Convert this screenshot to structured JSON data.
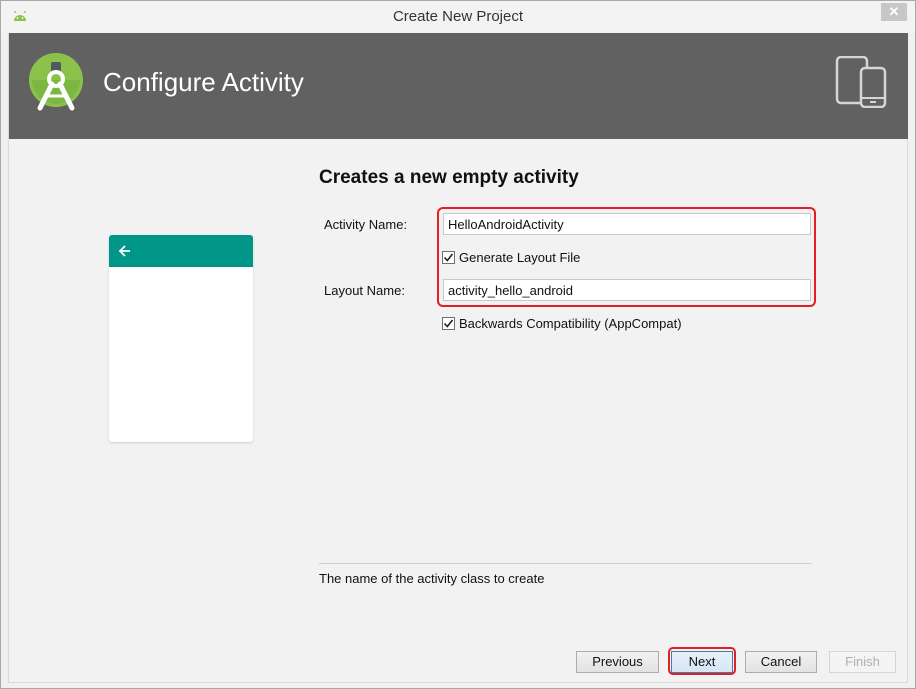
{
  "window": {
    "title": "Create New Project"
  },
  "header": {
    "title": "Configure Activity"
  },
  "form": {
    "section_title": "Creates a new empty activity",
    "activity_name_label": "Activity Name:",
    "activity_name_value": "HelloAndroidActivity",
    "generate_layout_label": "Generate Layout File",
    "generate_layout_checked": true,
    "layout_name_label": "Layout Name:",
    "layout_name_value": "activity_hello_android",
    "backwards_compat_label": "Backwards Compatibility (AppCompat)",
    "backwards_compat_checked": true,
    "hint": "The name of the activity class to create"
  },
  "buttons": {
    "previous": "Previous",
    "next": "Next",
    "cancel": "Cancel",
    "finish": "Finish",
    "finish_enabled": false
  },
  "colors": {
    "header_bg": "#616161",
    "preview_appbar": "#009688",
    "android_green": "#8bc34a",
    "highlight": "#e31e24"
  },
  "icons": {
    "app": "android-icon",
    "logo": "android-studio-logo",
    "devices": "devices-icon",
    "back": "back-arrow-icon",
    "close": "close-icon",
    "check": "check-icon"
  }
}
